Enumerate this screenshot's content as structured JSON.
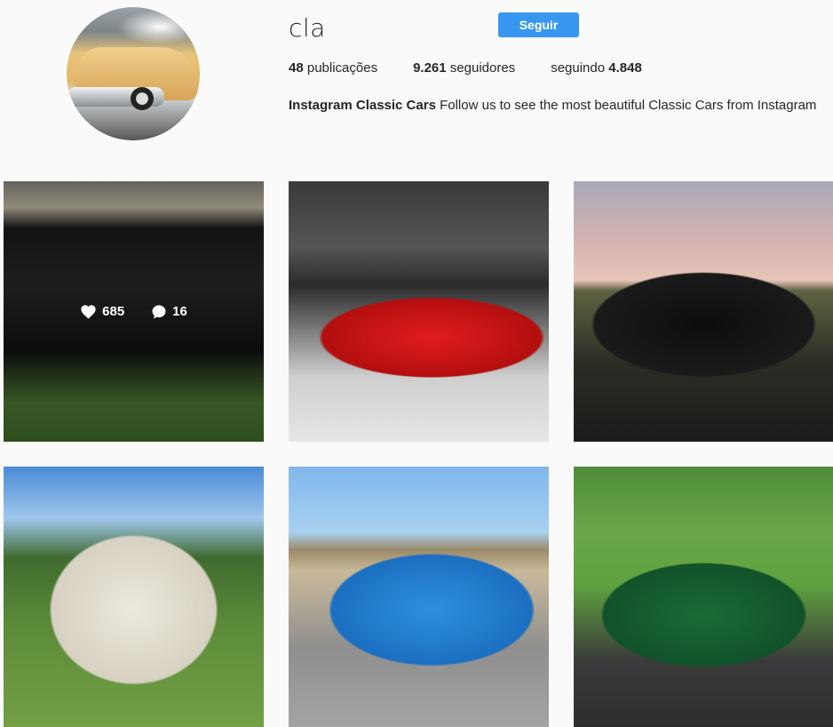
{
  "profile": {
    "username": "cla",
    "follow_label": "Seguir",
    "stats": {
      "posts_count": "48",
      "posts_label": "publicações",
      "followers_count": "9.261",
      "followers_label": "seguidores",
      "following_label": "seguindo",
      "following_count": "4.848"
    },
    "bio": {
      "name": "Instagram Classic Cars",
      "text": "Follow us to see the most beautiful Classic Cars from Instagram"
    }
  },
  "posts": [
    {
      "likes": "685",
      "comments": "16",
      "hovered": true
    },
    {
      "hovered": false
    },
    {
      "hovered": false
    },
    {
      "hovered": false
    },
    {
      "hovered": false
    },
    {
      "hovered": false
    }
  ],
  "colors": {
    "accent": "#3897f0",
    "text": "#262626",
    "background": "#fafafa"
  }
}
